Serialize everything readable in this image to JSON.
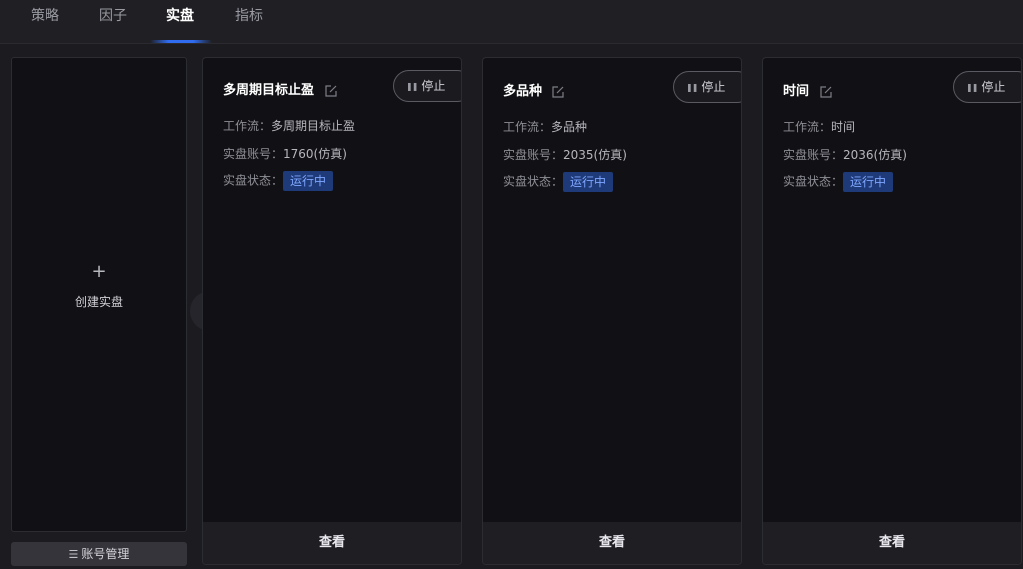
{
  "tabs": [
    {
      "label": "策略",
      "active": false
    },
    {
      "label": "因子",
      "active": false
    },
    {
      "label": "实盘",
      "active": true
    },
    {
      "label": "指标",
      "active": false
    }
  ],
  "create_panel": {
    "plus": "+",
    "label": "创建实盘"
  },
  "account_button": {
    "label": "账号管理"
  },
  "cards": [
    {
      "title": "多周期目标止盈",
      "stop_label": "停止",
      "workflow_label": "工作流：",
      "workflow_value": "多周期目标止盈",
      "account_label": "实盘账号：",
      "account_value": "1760(仿真)",
      "status_label": "实盘状态：",
      "status_value": "运行中",
      "view_label": "查看"
    },
    {
      "title": "多品种",
      "stop_label": "停止",
      "workflow_label": "工作流：",
      "workflow_value": "多品种",
      "account_label": "实盘账号：",
      "account_value": "2035(仿真)",
      "status_label": "实盘状态：",
      "status_value": "运行中",
      "view_label": "查看"
    },
    {
      "title": "时间",
      "stop_label": "停止",
      "workflow_label": "工作流：",
      "workflow_value": "时间",
      "account_label": "实盘账号：",
      "account_value": "2036(仿真)",
      "status_label": "实盘状态：",
      "status_value": "运行中",
      "view_label": "查看"
    }
  ],
  "colors": {
    "accent": "#2f6cf0",
    "status_badge_bg": "#1f3a78",
    "status_badge_text": "#7ea6ff",
    "card_bg": "#111115",
    "page_bg": "#1c1c20"
  },
  "icons": {
    "edit": "edit-icon",
    "pause": "pause-icon",
    "prev": "chevron-left-icon",
    "list": "list-icon",
    "plus": "plus-icon"
  }
}
